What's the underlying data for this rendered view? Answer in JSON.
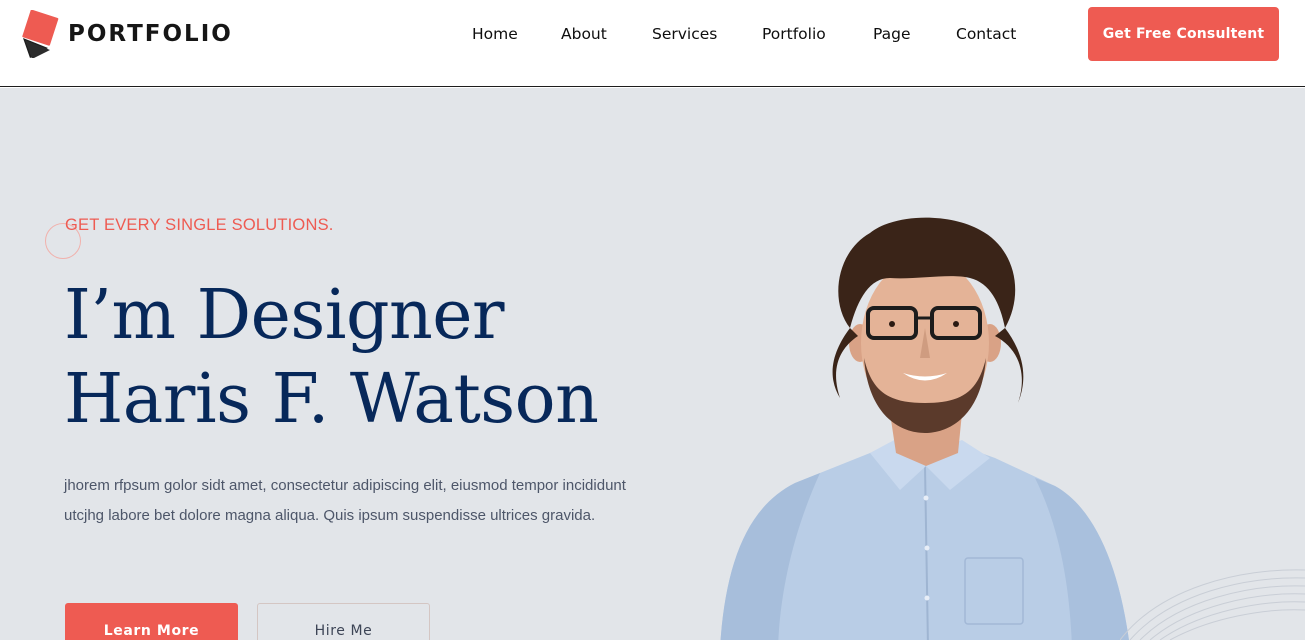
{
  "header": {
    "logo_text": "PORTFOLIO",
    "nav": [
      {
        "label": "Home"
      },
      {
        "label": "About"
      },
      {
        "label": "Services"
      },
      {
        "label": "Portfolio"
      },
      {
        "label": "Page"
      },
      {
        "label": "Contact"
      }
    ],
    "cta_label": "Get Free Consultent"
  },
  "hero": {
    "eyebrow": "GET EVERY SINGLE SOLUTIONS.",
    "title_line1": "I’m Designer",
    "title_line2": "Haris F. Watson",
    "description": "jhorem rfpsum golor sidt amet, consectetur adipiscing elit, eiusmod tempor incididunt utcjhg labore bet dolore magna aliqua. Quis ipsum suspendisse ultrices gravida.",
    "primary_button": "Learn More",
    "secondary_button": "Hire Me"
  },
  "colors": {
    "accent": "#ee5b52",
    "heading": "#07285a",
    "hero_bg": "#e2e5e9",
    "body_text": "#4d5669"
  },
  "icons": {
    "logo": "stacked-squares-logo-icon"
  }
}
